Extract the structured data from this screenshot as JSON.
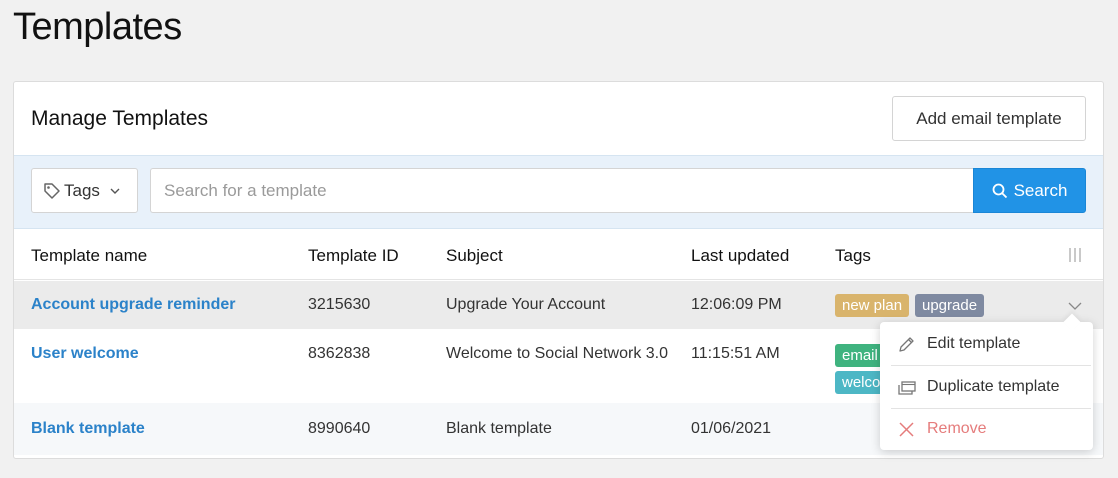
{
  "page": {
    "title": "Templates"
  },
  "panel": {
    "title": "Manage Templates",
    "add_button": "Add email template"
  },
  "filters": {
    "tags_label": "Tags",
    "search_placeholder": "Search for a template",
    "search_button": "Search"
  },
  "table": {
    "headers": {
      "name": "Template name",
      "id": "Template ID",
      "subject": "Subject",
      "updated": "Last updated",
      "tags": "Tags"
    },
    "rows": [
      {
        "name": "Account upgrade reminder",
        "id": "3215630",
        "subject": "Upgrade Your Account",
        "updated": "12:06:09 PM",
        "tags": [
          {
            "label": "new plan",
            "color": "#d9b46c"
          },
          {
            "label": "upgrade",
            "color": "#7f8aa1"
          }
        ]
      },
      {
        "name": "User welcome",
        "id": "8362838",
        "subject": "Welcome to Social Network 3.0",
        "updated": "11:15:51 AM",
        "tags": [
          {
            "label": "email",
            "color": "#3fb37f"
          },
          {
            "label": "welco",
            "color": "#4db7c5"
          }
        ]
      },
      {
        "name": "Blank template",
        "id": "8990640",
        "subject": "Blank template",
        "updated": "01/06/2021",
        "tags": []
      }
    ]
  },
  "row_menu": {
    "items": [
      {
        "label": "Edit template",
        "icon": "pencil-icon",
        "color": "#333333"
      },
      {
        "label": "Duplicate template",
        "icon": "duplicate-icon",
        "color": "#333333"
      },
      {
        "label": "Remove",
        "icon": "close-icon",
        "color": "#e57c7c"
      }
    ]
  },
  "colors": {
    "accent": "#2193e6",
    "link": "#2b82c9",
    "filter_bg": "#e8f1fa"
  }
}
